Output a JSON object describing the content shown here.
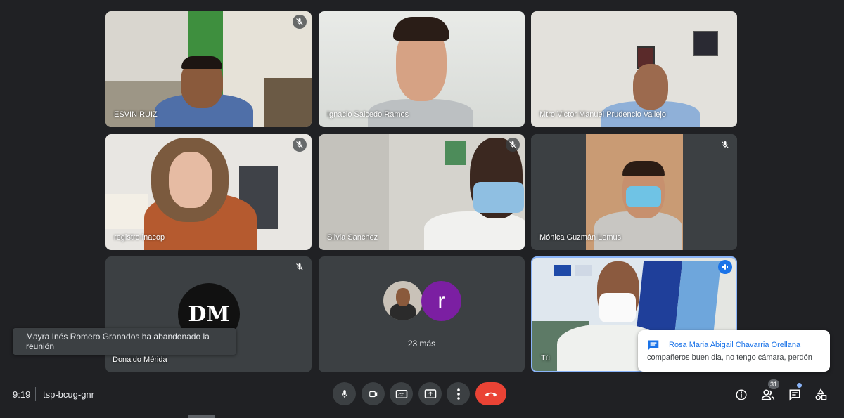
{
  "participants": [
    {
      "name": "ESVIN RUIZ",
      "mic": "off"
    },
    {
      "name": "Ignacio Salcedo Ramos",
      "mic": "on"
    },
    {
      "name": "Mtro Victor Manuel Prudencio Vallejo",
      "mic": "on"
    },
    {
      "name": "registro inacop",
      "mic": "off"
    },
    {
      "name": "Silvia Sanchez",
      "mic": "off"
    },
    {
      "name": "Mónica Guzmán Lemus",
      "mic": "off"
    },
    {
      "name": "Donaldo Mérida",
      "mic": "off",
      "avatar_initials": "DM"
    },
    {
      "name": "Tú",
      "mic": "speaking"
    }
  ],
  "overflow": {
    "label": "23 más",
    "avatar_letter": "r"
  },
  "toast": {
    "text": "Mayra Inés Romero Granados ha abandonado la reunión"
  },
  "chat_popup": {
    "sender": "Rosa Maria Abigail Chavarria Orellana",
    "message": "compañeros buen dia, no tengo cámara, perdón"
  },
  "meeting": {
    "time": "9:19",
    "code": "tsp-bcug-gnr"
  },
  "people_count": "31",
  "colors": {
    "background": "#202124",
    "tile": "#3c4043",
    "end_call": "#ea4335",
    "accent": "#1a73e8"
  },
  "icons": {
    "mic": "mic-icon",
    "camera": "camera-icon",
    "captions": "captions-icon",
    "present": "present-icon",
    "more": "more-options-icon",
    "end": "end-call-icon",
    "info": "info-icon",
    "people": "people-icon",
    "chat": "chat-icon",
    "activities": "activities-icon"
  }
}
